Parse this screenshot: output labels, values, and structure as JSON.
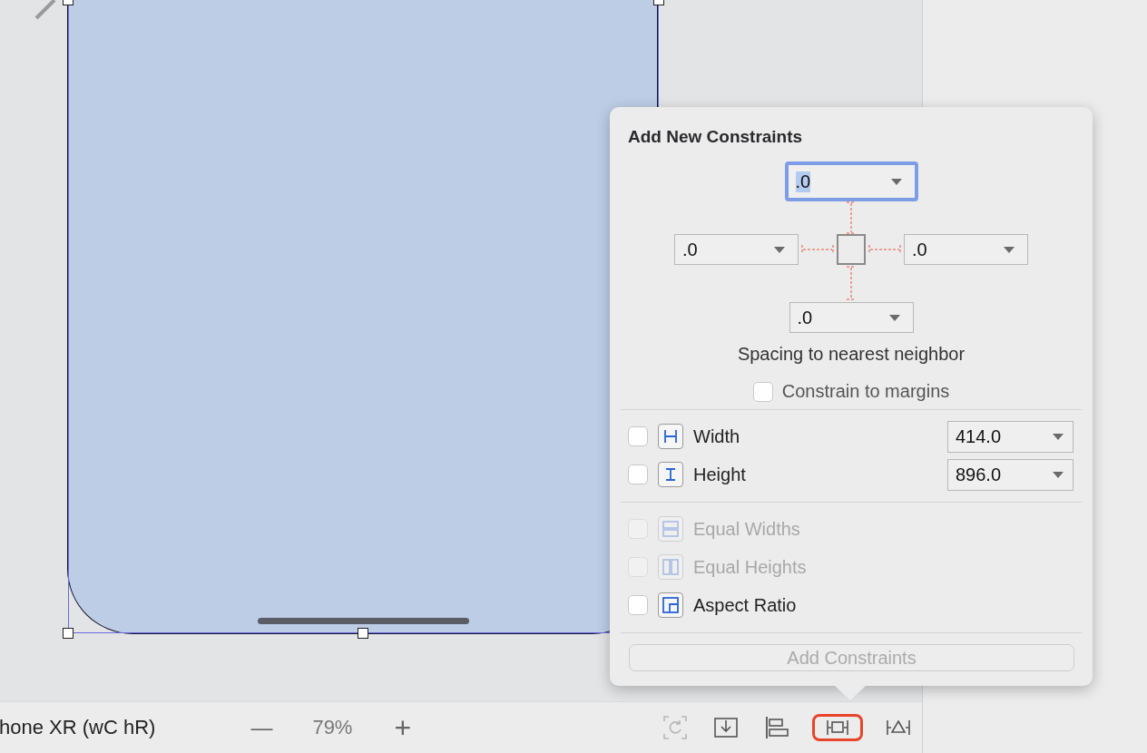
{
  "canvas": {
    "device_label": "hone XR (wC hR)",
    "zoom_out": "—",
    "zoom": "79%",
    "zoom_in": "+"
  },
  "toolbar": [
    {
      "kind": "update-frames",
      "disabled": true,
      "selected": false
    },
    {
      "kind": "embed",
      "disabled": false,
      "selected": false
    },
    {
      "kind": "align",
      "disabled": false,
      "selected": false
    },
    {
      "kind": "add-constraints",
      "disabled": false,
      "selected": true
    },
    {
      "kind": "resolve",
      "disabled": false,
      "selected": false
    }
  ],
  "popover": {
    "title": "Add New Constraints",
    "spacing_fields": [
      {
        "kind": "top",
        "value": ".0",
        "focused": true
      },
      {
        "kind": "left",
        "value": ".0",
        "focused": false
      },
      {
        "kind": "right",
        "value": ".0",
        "focused": false
      },
      {
        "kind": "bottom",
        "value": ".0",
        "focused": false
      }
    ],
    "spacing_caption": "Spacing to nearest neighbor",
    "margins": {
      "label": "Constrain to margins",
      "checked": false
    },
    "constraint_groups": [
      [
        {
          "kind": "width",
          "label": "Width",
          "checked": false,
          "disabled": false,
          "value": "414.0"
        },
        {
          "kind": "height",
          "label": "Height",
          "checked": false,
          "disabled": false,
          "value": "896.0"
        }
      ],
      [
        {
          "kind": "equal-widths",
          "label": "Equal Widths",
          "checked": false,
          "disabled": true
        },
        {
          "kind": "equal-heights",
          "label": "Equal Heights",
          "checked": false,
          "disabled": true
        },
        {
          "kind": "aspect-ratio",
          "label": "Aspect Ratio",
          "checked": false,
          "disabled": false
        }
      ]
    ],
    "button": {
      "label": "Add Constraints",
      "disabled": true
    }
  }
}
